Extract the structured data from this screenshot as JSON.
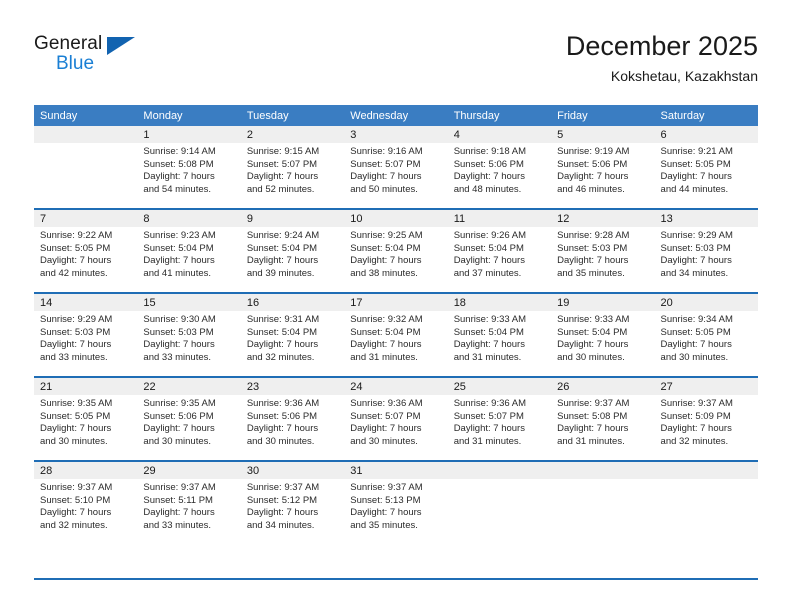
{
  "brand": {
    "name_top": "General",
    "name_bottom": "Blue",
    "accent_color": "#1263b0",
    "blue_text_color": "#1a7fd4"
  },
  "header": {
    "title": "December 2025",
    "subtitle": "Kokshetau, Kazakhstan"
  },
  "theme": {
    "header_row_bg": "#3a7dc2",
    "row_divider": "#1f6db5",
    "daynum_band_bg": "#efefef"
  },
  "weekday_headers": [
    "Sunday",
    "Monday",
    "Tuesday",
    "Wednesday",
    "Thursday",
    "Friday",
    "Saturday"
  ],
  "weeks": [
    [
      {
        "day": "",
        "sunrise": "",
        "sunset": "",
        "daylight_line1": "",
        "daylight_line2": ""
      },
      {
        "day": "1",
        "sunrise": "Sunrise: 9:14 AM",
        "sunset": "Sunset: 5:08 PM",
        "daylight_line1": "Daylight: 7 hours",
        "daylight_line2": "and 54 minutes."
      },
      {
        "day": "2",
        "sunrise": "Sunrise: 9:15 AM",
        "sunset": "Sunset: 5:07 PM",
        "daylight_line1": "Daylight: 7 hours",
        "daylight_line2": "and 52 minutes."
      },
      {
        "day": "3",
        "sunrise": "Sunrise: 9:16 AM",
        "sunset": "Sunset: 5:07 PM",
        "daylight_line1": "Daylight: 7 hours",
        "daylight_line2": "and 50 minutes."
      },
      {
        "day": "4",
        "sunrise": "Sunrise: 9:18 AM",
        "sunset": "Sunset: 5:06 PM",
        "daylight_line1": "Daylight: 7 hours",
        "daylight_line2": "and 48 minutes."
      },
      {
        "day": "5",
        "sunrise": "Sunrise: 9:19 AM",
        "sunset": "Sunset: 5:06 PM",
        "daylight_line1": "Daylight: 7 hours",
        "daylight_line2": "and 46 minutes."
      },
      {
        "day": "6",
        "sunrise": "Sunrise: 9:21 AM",
        "sunset": "Sunset: 5:05 PM",
        "daylight_line1": "Daylight: 7 hours",
        "daylight_line2": "and 44 minutes."
      }
    ],
    [
      {
        "day": "7",
        "sunrise": "Sunrise: 9:22 AM",
        "sunset": "Sunset: 5:05 PM",
        "daylight_line1": "Daylight: 7 hours",
        "daylight_line2": "and 42 minutes."
      },
      {
        "day": "8",
        "sunrise": "Sunrise: 9:23 AM",
        "sunset": "Sunset: 5:04 PM",
        "daylight_line1": "Daylight: 7 hours",
        "daylight_line2": "and 41 minutes."
      },
      {
        "day": "9",
        "sunrise": "Sunrise: 9:24 AM",
        "sunset": "Sunset: 5:04 PM",
        "daylight_line1": "Daylight: 7 hours",
        "daylight_line2": "and 39 minutes."
      },
      {
        "day": "10",
        "sunrise": "Sunrise: 9:25 AM",
        "sunset": "Sunset: 5:04 PM",
        "daylight_line1": "Daylight: 7 hours",
        "daylight_line2": "and 38 minutes."
      },
      {
        "day": "11",
        "sunrise": "Sunrise: 9:26 AM",
        "sunset": "Sunset: 5:04 PM",
        "daylight_line1": "Daylight: 7 hours",
        "daylight_line2": "and 37 minutes."
      },
      {
        "day": "12",
        "sunrise": "Sunrise: 9:28 AM",
        "sunset": "Sunset: 5:03 PM",
        "daylight_line1": "Daylight: 7 hours",
        "daylight_line2": "and 35 minutes."
      },
      {
        "day": "13",
        "sunrise": "Sunrise: 9:29 AM",
        "sunset": "Sunset: 5:03 PM",
        "daylight_line1": "Daylight: 7 hours",
        "daylight_line2": "and 34 minutes."
      }
    ],
    [
      {
        "day": "14",
        "sunrise": "Sunrise: 9:29 AM",
        "sunset": "Sunset: 5:03 PM",
        "daylight_line1": "Daylight: 7 hours",
        "daylight_line2": "and 33 minutes."
      },
      {
        "day": "15",
        "sunrise": "Sunrise: 9:30 AM",
        "sunset": "Sunset: 5:03 PM",
        "daylight_line1": "Daylight: 7 hours",
        "daylight_line2": "and 33 minutes."
      },
      {
        "day": "16",
        "sunrise": "Sunrise: 9:31 AM",
        "sunset": "Sunset: 5:04 PM",
        "daylight_line1": "Daylight: 7 hours",
        "daylight_line2": "and 32 minutes."
      },
      {
        "day": "17",
        "sunrise": "Sunrise: 9:32 AM",
        "sunset": "Sunset: 5:04 PM",
        "daylight_line1": "Daylight: 7 hours",
        "daylight_line2": "and 31 minutes."
      },
      {
        "day": "18",
        "sunrise": "Sunrise: 9:33 AM",
        "sunset": "Sunset: 5:04 PM",
        "daylight_line1": "Daylight: 7 hours",
        "daylight_line2": "and 31 minutes."
      },
      {
        "day": "19",
        "sunrise": "Sunrise: 9:33 AM",
        "sunset": "Sunset: 5:04 PM",
        "daylight_line1": "Daylight: 7 hours",
        "daylight_line2": "and 30 minutes."
      },
      {
        "day": "20",
        "sunrise": "Sunrise: 9:34 AM",
        "sunset": "Sunset: 5:05 PM",
        "daylight_line1": "Daylight: 7 hours",
        "daylight_line2": "and 30 minutes."
      }
    ],
    [
      {
        "day": "21",
        "sunrise": "Sunrise: 9:35 AM",
        "sunset": "Sunset: 5:05 PM",
        "daylight_line1": "Daylight: 7 hours",
        "daylight_line2": "and 30 minutes."
      },
      {
        "day": "22",
        "sunrise": "Sunrise: 9:35 AM",
        "sunset": "Sunset: 5:06 PM",
        "daylight_line1": "Daylight: 7 hours",
        "daylight_line2": "and 30 minutes."
      },
      {
        "day": "23",
        "sunrise": "Sunrise: 9:36 AM",
        "sunset": "Sunset: 5:06 PM",
        "daylight_line1": "Daylight: 7 hours",
        "daylight_line2": "and 30 minutes."
      },
      {
        "day": "24",
        "sunrise": "Sunrise: 9:36 AM",
        "sunset": "Sunset: 5:07 PM",
        "daylight_line1": "Daylight: 7 hours",
        "daylight_line2": "and 30 minutes."
      },
      {
        "day": "25",
        "sunrise": "Sunrise: 9:36 AM",
        "sunset": "Sunset: 5:07 PM",
        "daylight_line1": "Daylight: 7 hours",
        "daylight_line2": "and 31 minutes."
      },
      {
        "day": "26",
        "sunrise": "Sunrise: 9:37 AM",
        "sunset": "Sunset: 5:08 PM",
        "daylight_line1": "Daylight: 7 hours",
        "daylight_line2": "and 31 minutes."
      },
      {
        "day": "27",
        "sunrise": "Sunrise: 9:37 AM",
        "sunset": "Sunset: 5:09 PM",
        "daylight_line1": "Daylight: 7 hours",
        "daylight_line2": "and 32 minutes."
      }
    ],
    [
      {
        "day": "28",
        "sunrise": "Sunrise: 9:37 AM",
        "sunset": "Sunset: 5:10 PM",
        "daylight_line1": "Daylight: 7 hours",
        "daylight_line2": "and 32 minutes."
      },
      {
        "day": "29",
        "sunrise": "Sunrise: 9:37 AM",
        "sunset": "Sunset: 5:11 PM",
        "daylight_line1": "Daylight: 7 hours",
        "daylight_line2": "and 33 minutes."
      },
      {
        "day": "30",
        "sunrise": "Sunrise: 9:37 AM",
        "sunset": "Sunset: 5:12 PM",
        "daylight_line1": "Daylight: 7 hours",
        "daylight_line2": "and 34 minutes."
      },
      {
        "day": "31",
        "sunrise": "Sunrise: 9:37 AM",
        "sunset": "Sunset: 5:13 PM",
        "daylight_line1": "Daylight: 7 hours",
        "daylight_line2": "and 35 minutes."
      },
      {
        "day": "",
        "sunrise": "",
        "sunset": "",
        "daylight_line1": "",
        "daylight_line2": ""
      },
      {
        "day": "",
        "sunrise": "",
        "sunset": "",
        "daylight_line1": "",
        "daylight_line2": ""
      },
      {
        "day": "",
        "sunrise": "",
        "sunset": "",
        "daylight_line1": "",
        "daylight_line2": ""
      }
    ]
  ]
}
